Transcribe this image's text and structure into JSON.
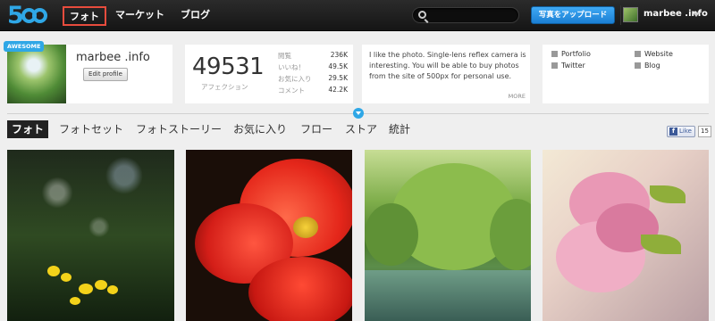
{
  "header": {
    "logo_text": "5",
    "nav": [
      "フォト",
      "マーケット",
      "ブログ"
    ],
    "search_placeholder": "",
    "upload_label": "写真をアップロード",
    "user_name": "marbee .info"
  },
  "profile": {
    "badge": "AWESOME",
    "name": "marbee .info",
    "edit_label": "Edit profile"
  },
  "stats": {
    "affection_value": "49531",
    "affection_label": "アフェクション",
    "rows": [
      {
        "label": "閲覧",
        "value": "236K"
      },
      {
        "label": "いいね！",
        "value": "49.5K"
      },
      {
        "label": "お気に入り",
        "value": "29.5K"
      },
      {
        "label": "コメント",
        "value": "42.2K"
      }
    ]
  },
  "about": {
    "text": "I like the photo. Single-lens reflex camera is interesting. You will be able to buy photos from the site of 500px for personal use.",
    "more_label": "MORE"
  },
  "links": [
    {
      "label": "Portfolio",
      "icon": "portfolio-icon"
    },
    {
      "label": "Twitter",
      "icon": "twitter-icon"
    },
    {
      "label": "Website",
      "icon": "website-icon"
    },
    {
      "label": "Blog",
      "icon": "blog-icon"
    }
  ],
  "tabs": [
    "フォト",
    "フォトセット",
    "フォトストーリー",
    "お気に入り",
    "フロー",
    "ストア",
    "統計"
  ],
  "facebook": {
    "like_label": "Like",
    "count": "15"
  },
  "colors": {
    "accent": "#2fa7e6",
    "highlight": "#e84c3d"
  }
}
